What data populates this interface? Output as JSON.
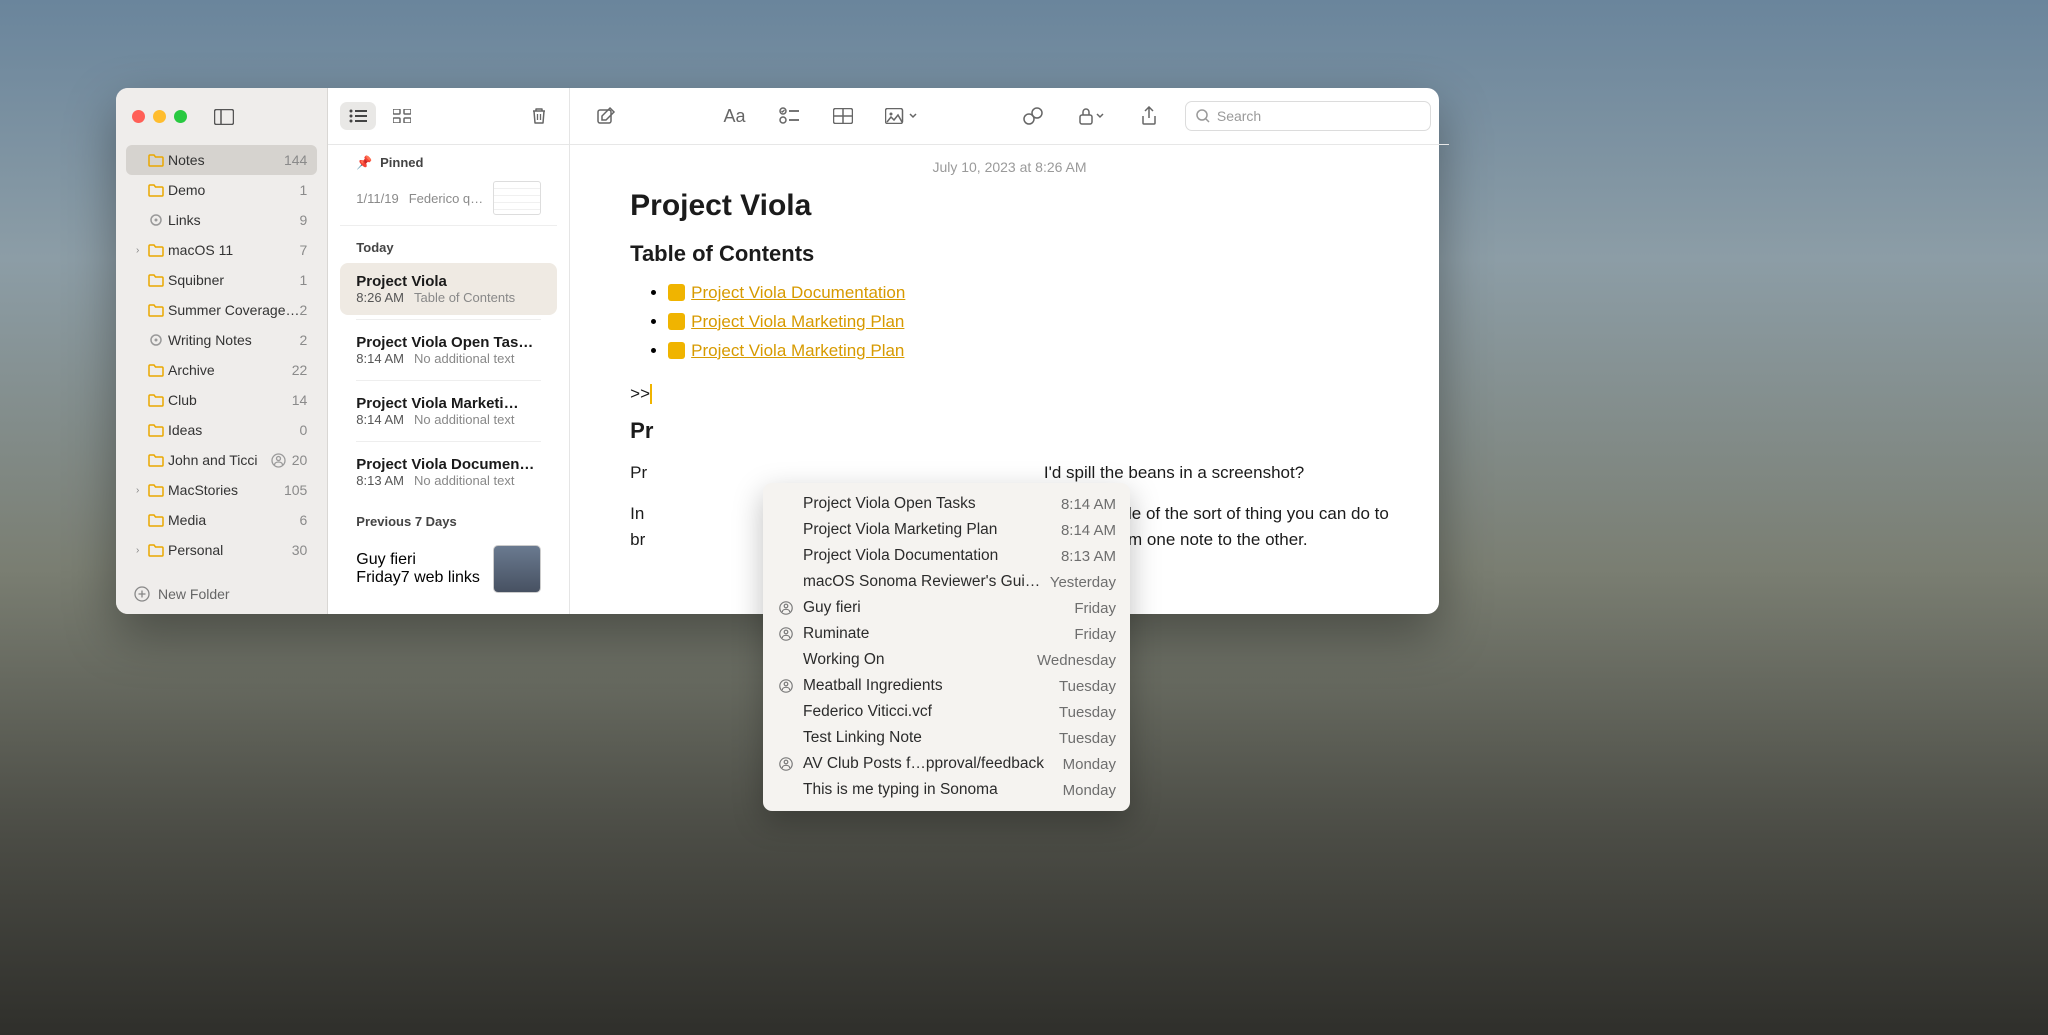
{
  "datestamp": "July 10, 2023 at 8:26 AM",
  "sidebar": {
    "new_folder": "New Folder",
    "folders": [
      {
        "label": "Notes",
        "count": "144",
        "icon": "folder",
        "sel": true,
        "chev": false
      },
      {
        "label": "Demo",
        "count": "1",
        "icon": "folder",
        "sel": false,
        "chev": false
      },
      {
        "label": "Links",
        "count": "9",
        "icon": "gear",
        "sel": false,
        "chev": false
      },
      {
        "label": "macOS 11",
        "count": "7",
        "icon": "folder",
        "sel": false,
        "chev": true
      },
      {
        "label": "Squibner",
        "count": "1",
        "icon": "folder",
        "sel": false,
        "chev": false
      },
      {
        "label": "Summer Coverage…",
        "count": "2",
        "icon": "folder",
        "sel": false,
        "chev": false
      },
      {
        "label": "Writing Notes",
        "count": "2",
        "icon": "gear",
        "sel": false,
        "chev": false
      },
      {
        "label": "Archive",
        "count": "22",
        "icon": "folder",
        "sel": false,
        "chev": false
      },
      {
        "label": "Club",
        "count": "14",
        "icon": "folder",
        "sel": false,
        "chev": false
      },
      {
        "label": "Ideas",
        "count": "0",
        "icon": "folder",
        "sel": false,
        "chev": false
      },
      {
        "label": "John and Ticci",
        "count": "20",
        "icon": "folder-shared",
        "sel": false,
        "chev": false,
        "shared": true
      },
      {
        "label": "MacStories",
        "count": "105",
        "icon": "folder",
        "sel": false,
        "chev": true
      },
      {
        "label": "Media",
        "count": "6",
        "icon": "folder",
        "sel": false,
        "chev": false
      },
      {
        "label": "Personal",
        "count": "30",
        "icon": "folder",
        "sel": false,
        "chev": true
      }
    ]
  },
  "list": {
    "pinned_label": "Pinned",
    "pinned": {
      "date": "1/11/19",
      "preview": "Federico q…"
    },
    "today_label": "Today",
    "today": [
      {
        "title": "Project Viola",
        "date": "8:26 AM",
        "preview": "Table of Contents",
        "sel": true
      },
      {
        "title": "Project Viola Open Tas…",
        "date": "8:14 AM",
        "preview": "No additional text",
        "sel": false
      },
      {
        "title": "Project Viola Marketi…",
        "date": "8:14 AM",
        "preview": "No additional text",
        "sel": false
      },
      {
        "title": "Project Viola Documen…",
        "date": "8:13 AM",
        "preview": "No additional text",
        "sel": false
      }
    ],
    "prev_label": "Previous 7 Days",
    "prev": [
      {
        "title": "Guy fieri",
        "date": "Friday",
        "preview": "7 web links"
      }
    ]
  },
  "note": {
    "title": "Project Viola",
    "toc_heading": "Table of Contents",
    "links": [
      "Project Viola Documentation",
      "Project Viola Marketing Plan",
      "Project Viola Marketing Plan"
    ],
    "trigger": ">>",
    "h2_partial": "Pr",
    "p1": "Pr                                                                                    I'd spill the beans in a screenshot?",
    "p2a": "In                                                                            is a good example of the sort of thing you can do to",
    "p2b": "br                                                                 g it easy to navigate from one note to the other."
  },
  "search_placeholder": "Search",
  "popup": [
    {
      "title": "Project Viola Open Tasks",
      "time": "8:14 AM",
      "icon": ""
    },
    {
      "title": "Project Viola Marketing Plan",
      "time": "8:14 AM",
      "icon": ""
    },
    {
      "title": "Project Viola Documentation",
      "time": "8:13 AM",
      "icon": ""
    },
    {
      "title": "macOS Sonoma Reviewer's Guide",
      "time": "Yesterday",
      "icon": ""
    },
    {
      "title": "Guy fieri",
      "time": "Friday",
      "icon": "person"
    },
    {
      "title": "Ruminate",
      "time": "Friday",
      "icon": "person"
    },
    {
      "title": "Working On",
      "time": "Wednesday",
      "icon": ""
    },
    {
      "title": "Meatball Ingredients",
      "time": "Tuesday",
      "icon": "person"
    },
    {
      "title": "Federico Viticci.vcf",
      "time": "Tuesday",
      "icon": ""
    },
    {
      "title": "Test Linking Note",
      "time": "Tuesday",
      "icon": ""
    },
    {
      "title": "AV Club Posts f…pproval/feedback",
      "time": "Monday",
      "icon": "person"
    },
    {
      "title": "This is me typing in Sonoma",
      "time": "Monday",
      "icon": ""
    }
  ]
}
